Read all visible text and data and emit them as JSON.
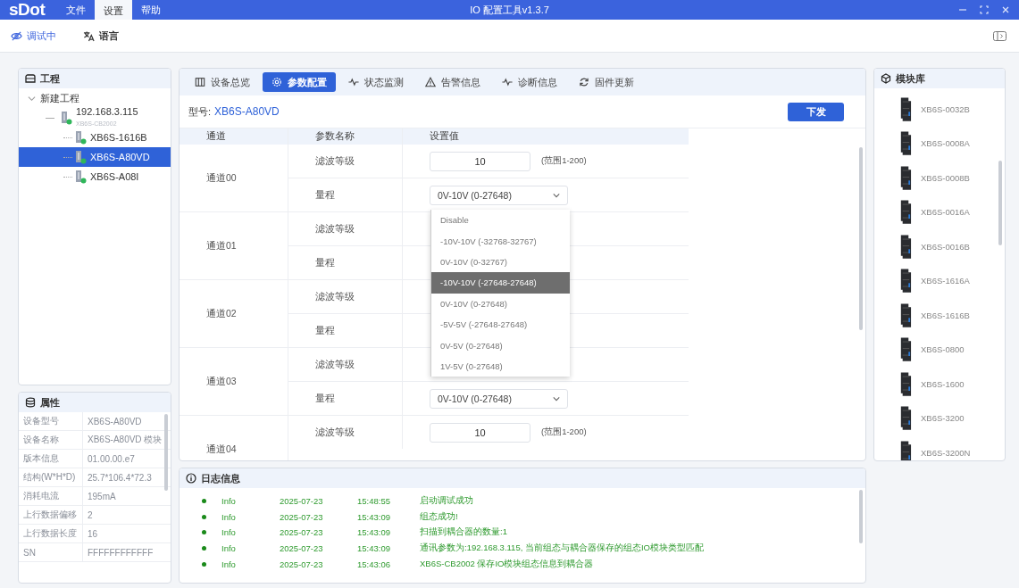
{
  "app": {
    "logo": "sDot",
    "title": "IO 配置工具v1.3.7"
  },
  "menu": [
    {
      "label": "文件",
      "selected": false
    },
    {
      "label": "设置",
      "selected": true
    },
    {
      "label": "帮助",
      "selected": false
    }
  ],
  "toolbar": [
    {
      "label": "调试中",
      "kind": "debug",
      "on": true
    },
    {
      "label": "语言",
      "kind": "language",
      "on": false
    }
  ],
  "project": {
    "title": "工程",
    "tree": [
      {
        "label": "新建工程",
        "expanded": true,
        "selected": false,
        "children": [
          {
            "label": "192.168.3.115",
            "sublabel": "XB6S-CB2002",
            "expanded": true,
            "selected": false,
            "children": [
              {
                "label": "XB6S-1616B",
                "selected": false
              },
              {
                "label": "XB6S-A80VD",
                "selected": true
              },
              {
                "label": "XB6S-A08I",
                "selected": false
              }
            ]
          }
        ]
      }
    ]
  },
  "properties": {
    "title": "属性",
    "rows": [
      {
        "label": "设备型号",
        "value": "XB6S-A80VD"
      },
      {
        "label": "设备名称",
        "value": "XB6S-A80VD 模块"
      },
      {
        "label": "版本信息",
        "value": "01.00.00.e7"
      },
      {
        "label": "结构(W*H*D)",
        "value": "25.7*106.4*72.3"
      },
      {
        "label": "消耗电流",
        "value": "195mA"
      },
      {
        "label": "上行数据偏移",
        "value": "2"
      },
      {
        "label": "上行数据长度",
        "value": "16"
      },
      {
        "label": "SN",
        "value": "FFFFFFFFFFFF"
      }
    ]
  },
  "tabs": [
    {
      "label": "设备总览",
      "kind": "overview",
      "selected": false
    },
    {
      "label": "参数配置",
      "kind": "settings",
      "selected": true
    },
    {
      "label": "状态监测",
      "kind": "pulse",
      "selected": false
    },
    {
      "label": "告警信息",
      "kind": "warning",
      "selected": false
    },
    {
      "label": "诊断信息",
      "kind": "pulse",
      "selected": false
    },
    {
      "label": "固件更新",
      "kind": "refresh",
      "selected": false
    }
  ],
  "model": {
    "label": "型号:",
    "value": "XB6S-A80VD"
  },
  "download_button": "下发",
  "table": {
    "columns": [
      "通道",
      "参数名称",
      "设置值"
    ],
    "channels": [
      {
        "name": "通道00",
        "params": [
          {
            "name": "滤波等级",
            "kind": "number",
            "value": "10",
            "hint": "(范围1-200)"
          },
          {
            "name": "量程",
            "kind": "select",
            "value": "0V-10V (0-27648)"
          }
        ]
      },
      {
        "name": "通道01",
        "params": [
          {
            "name": "滤波等级"
          },
          {
            "name": "量程"
          }
        ]
      },
      {
        "name": "通道02",
        "params": [
          {
            "name": "滤波等级"
          },
          {
            "name": "量程"
          }
        ]
      },
      {
        "name": "通道03",
        "params": [
          {
            "name": "滤波等级"
          },
          {
            "name": "量程",
            "kind": "select",
            "value": "0V-10V (0-27648)"
          }
        ]
      },
      {
        "name": "通道04",
        "params": [
          {
            "name": "滤波等级",
            "kind": "number",
            "value": "10",
            "hint": "(范围1-200)"
          }
        ]
      }
    ]
  },
  "dropdown": {
    "options": [
      {
        "label": "Disable",
        "selected": false
      },
      {
        "label": "-10V-10V (-32768-32767)",
        "selected": false
      },
      {
        "label": "0V-10V (0-32767)",
        "selected": false
      },
      {
        "label": "-10V-10V (-27648-27648)",
        "selected": true
      },
      {
        "label": "0V-10V (0-27648)",
        "selected": false
      },
      {
        "label": "-5V-5V (-27648-27648)",
        "selected": false
      },
      {
        "label": "0V-5V (0-27648)",
        "selected": false
      },
      {
        "label": "1V-5V (0-27648)",
        "selected": false
      }
    ]
  },
  "log": {
    "title": "日志信息",
    "entries": [
      {
        "level": "Info",
        "date": "2025-07-23",
        "time": "15:48:55",
        "message": "启动调试成功"
      },
      {
        "level": "Info",
        "date": "2025-07-23",
        "time": "15:43:09",
        "message": "组态成功!"
      },
      {
        "level": "Info",
        "date": "2025-07-23",
        "time": "15:43:09",
        "message": "扫描到耦合器的数量:1"
      },
      {
        "level": "Info",
        "date": "2025-07-23",
        "time": "15:43:09",
        "message": "通讯参数为:192.168.3.115, 当前组态与耦合器保存的组态IO模块类型匹配"
      },
      {
        "level": "Info",
        "date": "2025-07-23",
        "time": "15:43:06",
        "message": "XB6S-CB2002 保存IO模块组态信息到耦合器"
      }
    ]
  },
  "library": {
    "title": "模块库",
    "modules": [
      "XB6S-0032B",
      "XB6S-0008A",
      "XB6S-0008B",
      "XB6S-0016A",
      "XB6S-0016B",
      "XB6S-1616A",
      "XB6S-1616B",
      "XB6S-0800",
      "XB6S-1600",
      "XB6S-3200",
      "XB6S-3200N"
    ]
  }
}
